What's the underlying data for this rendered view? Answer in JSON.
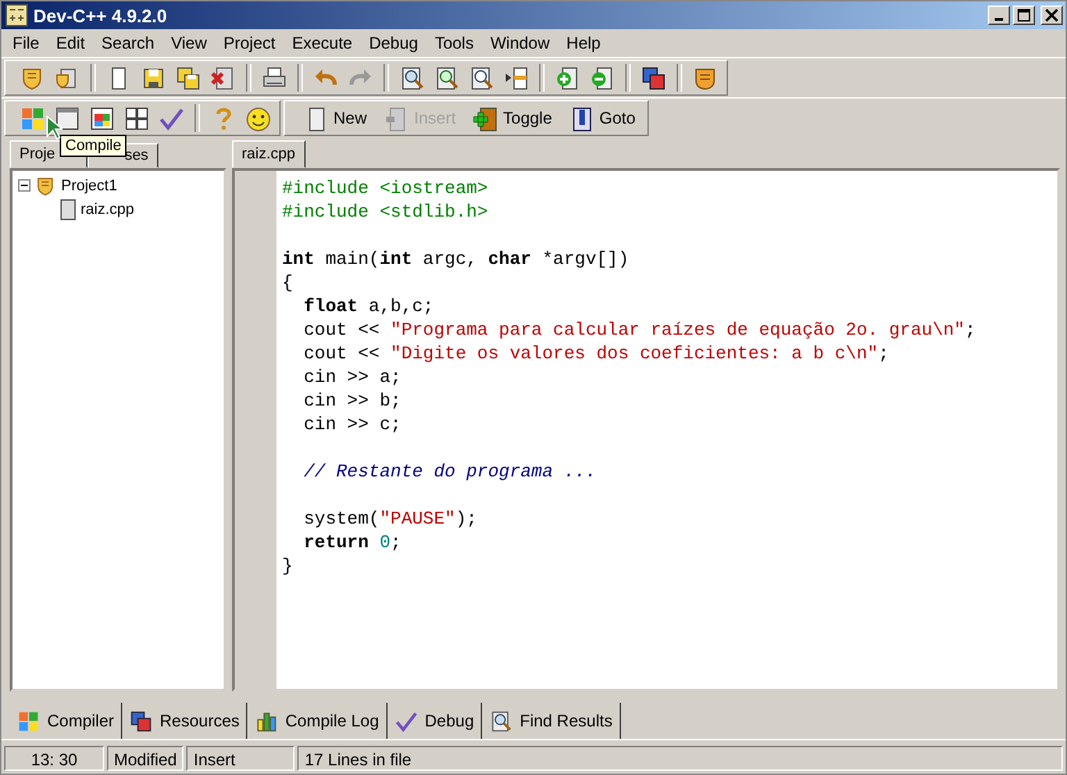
{
  "window": {
    "title": "Dev-C++ 4.9.2.0"
  },
  "menu": [
    "File",
    "Edit",
    "Search",
    "View",
    "Project",
    "Execute",
    "Debug",
    "Tools",
    "Window",
    "Help"
  ],
  "bookmark_buttons": [
    {
      "label": "New",
      "disabled": false
    },
    {
      "label": "Insert",
      "disabled": true
    },
    {
      "label": "Toggle",
      "disabled": false
    },
    {
      "label": "Goto",
      "disabled": false
    }
  ],
  "tooltip": "Compile",
  "left_tabs": [
    {
      "label": "Proje",
      "selected": true
    },
    {
      "label": "ses",
      "selected": false
    }
  ],
  "tree": [
    {
      "label": "Project1",
      "expanded": true,
      "children": [
        {
          "label": "raiz.cpp"
        }
      ]
    }
  ],
  "editor_tabs": [
    {
      "label": "raiz.cpp",
      "selected": true
    }
  ],
  "code": [
    {
      "kind": "code",
      "tokens": [
        {
          "kind": "directive",
          "text": "#include <iostream>"
        }
      ]
    },
    {
      "kind": "code",
      "tokens": [
        {
          "kind": "directive",
          "text": "#include <stdlib.h>"
        }
      ]
    },
    {
      "kind": "blank"
    },
    {
      "kind": "code",
      "tokens": [
        {
          "kind": "keyword",
          "text": "int"
        },
        {
          "kind": "plain",
          "text": " main("
        },
        {
          "kind": "keyword",
          "text": "int"
        },
        {
          "kind": "plain",
          "text": " argc, "
        },
        {
          "kind": "keyword",
          "text": "char"
        },
        {
          "kind": "plain",
          "text": " *argv[])"
        }
      ]
    },
    {
      "kind": "code",
      "tokens": [
        {
          "kind": "plain",
          "text": "{"
        }
      ]
    },
    {
      "kind": "code",
      "tokens": [
        {
          "kind": "keyword",
          "text": "  float"
        },
        {
          "kind": "plain",
          "text": " a,b,c;"
        }
      ]
    },
    {
      "kind": "code",
      "tokens": [
        {
          "kind": "plain",
          "text": "  cout << "
        },
        {
          "kind": "string",
          "text": "\"Programa para calcular raízes de equação 2o. grau\\n\""
        },
        {
          "kind": "plain",
          "text": ";"
        }
      ]
    },
    {
      "kind": "code",
      "tokens": [
        {
          "kind": "plain",
          "text": "  cout << "
        },
        {
          "kind": "string",
          "text": "\"Digite os valores dos coeficientes: a b c\\n\""
        },
        {
          "kind": "plain",
          "text": ";"
        }
      ]
    },
    {
      "kind": "code",
      "tokens": [
        {
          "kind": "plain",
          "text": "  cin >> a;"
        }
      ]
    },
    {
      "kind": "code",
      "tokens": [
        {
          "kind": "plain",
          "text": "  cin >> b;"
        }
      ]
    },
    {
      "kind": "code",
      "tokens": [
        {
          "kind": "plain",
          "text": "  cin >> c;"
        }
      ]
    },
    {
      "kind": "blank"
    },
    {
      "kind": "code",
      "tokens": [
        {
          "kind": "comment",
          "text": "  // Restante do programa ..."
        }
      ]
    },
    {
      "kind": "blank"
    },
    {
      "kind": "code",
      "tokens": [
        {
          "kind": "plain",
          "text": "  system("
        },
        {
          "kind": "string",
          "text": "\"PAUSE\""
        },
        {
          "kind": "plain",
          "text": ");"
        }
      ]
    },
    {
      "kind": "code",
      "tokens": [
        {
          "kind": "keyword",
          "text": "  return"
        },
        {
          "kind": "number",
          "text": " 0"
        },
        {
          "kind": "plain",
          "text": ";"
        }
      ]
    },
    {
      "kind": "code",
      "tokens": [
        {
          "kind": "plain",
          "text": "}"
        }
      ]
    }
  ],
  "bottom_tabs": [
    {
      "label": "Compiler",
      "selected": false
    },
    {
      "label": "Resources",
      "selected": false
    },
    {
      "label": "Compile Log",
      "selected": false
    },
    {
      "label": "Debug",
      "selected": false
    },
    {
      "label": "Find Results",
      "selected": false
    }
  ],
  "status_bar": [
    "13: 30",
    "Modified",
    "Insert",
    "17 Lines in file"
  ]
}
